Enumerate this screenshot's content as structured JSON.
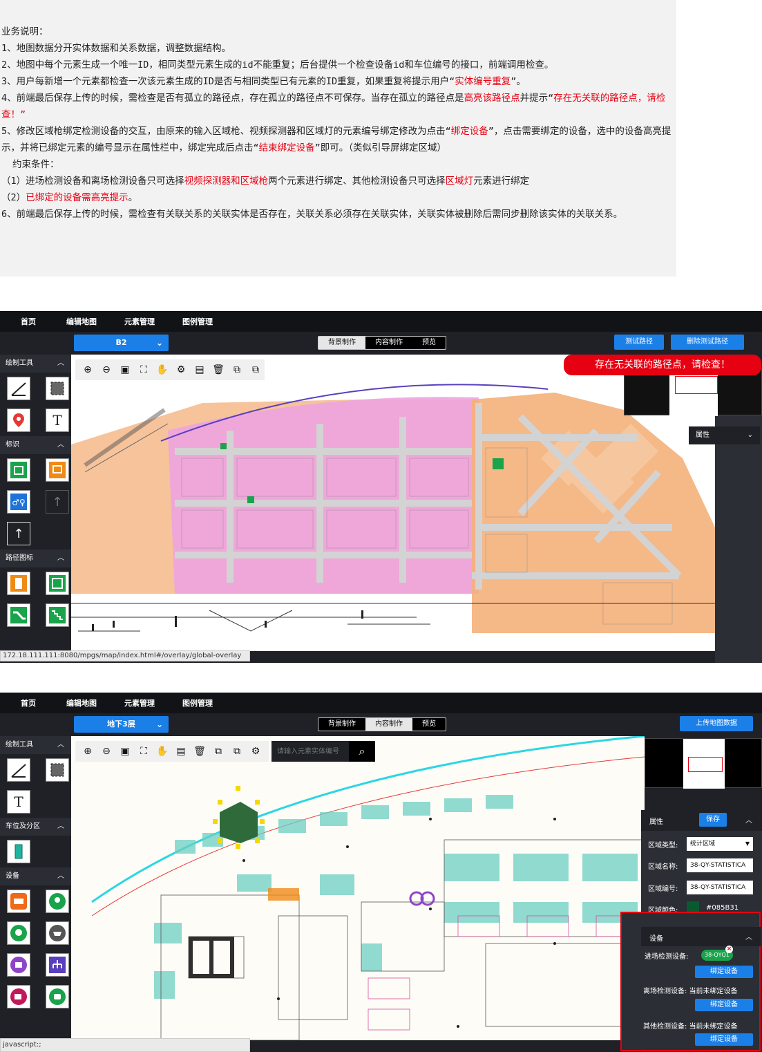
{
  "doc": {
    "heading": "业务说明：",
    "line1": "1、地图数据分开实体数据和关系数据，调整数据结构。",
    "line2": "2、地图中每个元素生成一个唯一ID，相同类型元素生成的id不能重复；后台提供一个检查设备id和车位编号的接口，前端调用检查。",
    "line3_a": "3、用户每新增一个元素都检查一次该元素生成的ID是否与相同类型已有元素的ID重复，如果重复将提示用户“",
    "line3_red": "实体编号重复",
    "line3_b": "”。",
    "line4_a": "4、前端最后保存上传的时候，需检查是否有孤立的路径点，存在孤立的路径点不可保存。当存在孤立的路径点是",
    "line4_red1": "高亮该路径点",
    "line4_b": "并提示“",
    "line4_red2": "存在无关联的路径点，请检查！”",
    "line5_a": "5、修改区域枪绑定检测设备的交互，由原来的输入区域枪、视频探测器和区域灯的元素编号绑定修改为点击“",
    "line5_red1": "绑定设备",
    "line5_b": "”，点击需要绑定的设备，选中的设备高亮提示，并将已绑定元素的编号显示在属性栏中，绑定完成后点击“",
    "line5_red2": "结束绑定设备",
    "line5_c": "”即可。（类似引导屏绑定区域）",
    "constraint_title": "约束条件：",
    "c1_a": "（1）进场检测设备和离场检测设备只可选择",
    "c1_red1": "视频探测器和区域枪",
    "c1_b": "两个元素进行绑定、其他检测设备只可选择",
    "c1_red2": "区域灯",
    "c1_c": "元素进行绑定",
    "c2_a": "（2）",
    "c2_red": "已绑定的设备需高亮提示",
    "c2_b": "。",
    "line6": "6、前端最后保存上传的时候，需检查有关联关系的关联实体是否存在，关联关系必须存在关联实体，关联实体被删除后需同步删除该实体的关联关系。"
  },
  "nav": {
    "home": "首页",
    "edit_map": "编辑地图",
    "elements": "元素管理",
    "legend": "图例管理"
  },
  "modes": {
    "bg": "背景制作",
    "content": "内容制作",
    "preview": "预览"
  },
  "app1": {
    "floor": "B2",
    "test_path_btn": "测试路径",
    "delete_test_path_btn": "删除测试路径",
    "alert": "存在无关联的路径点，请检查！",
    "properties": "属性",
    "sections": {
      "draw": "绘制工具",
      "signs": "标识",
      "path_icons": "路径图标"
    },
    "url": "172.18.111.111:8080/mpgs/map/index.html#/overlay/global-overlay"
  },
  "app2": {
    "floor": "地下3层",
    "upload_btn": "上传地图数据",
    "search_placeholder": "请输入元素实体编号",
    "sections": {
      "draw": "绘制工具",
      "parking": "车位及分区",
      "devices": "设备"
    },
    "props": {
      "title": "属性",
      "save": "保存",
      "type_label": "区域类型:",
      "type_value": "统计区域",
      "name_label": "区域名称:",
      "name_value": "38-QY-STATISTICA",
      "code_label": "区域编号:",
      "code_value": "38-QY-STATISTICA",
      "color_label": "区域颜色:",
      "color_value": "#085B31"
    },
    "devices": {
      "title": "设备",
      "entry_label": "进场检测设备:",
      "entry_tag": "38-QYQ1",
      "bind": "绑定设备",
      "exit_label": "离场检测设备: 当前未绑定设备",
      "other_label": "其他检测设备: 当前未绑定设备"
    },
    "url": "javascript:;"
  },
  "colors": {
    "accent": "#1b7fe8",
    "alert": "#e60012",
    "pink_zone": "#e9a7de",
    "orange_zone": "#f2b07a",
    "green_area": "#2f6b3a"
  }
}
